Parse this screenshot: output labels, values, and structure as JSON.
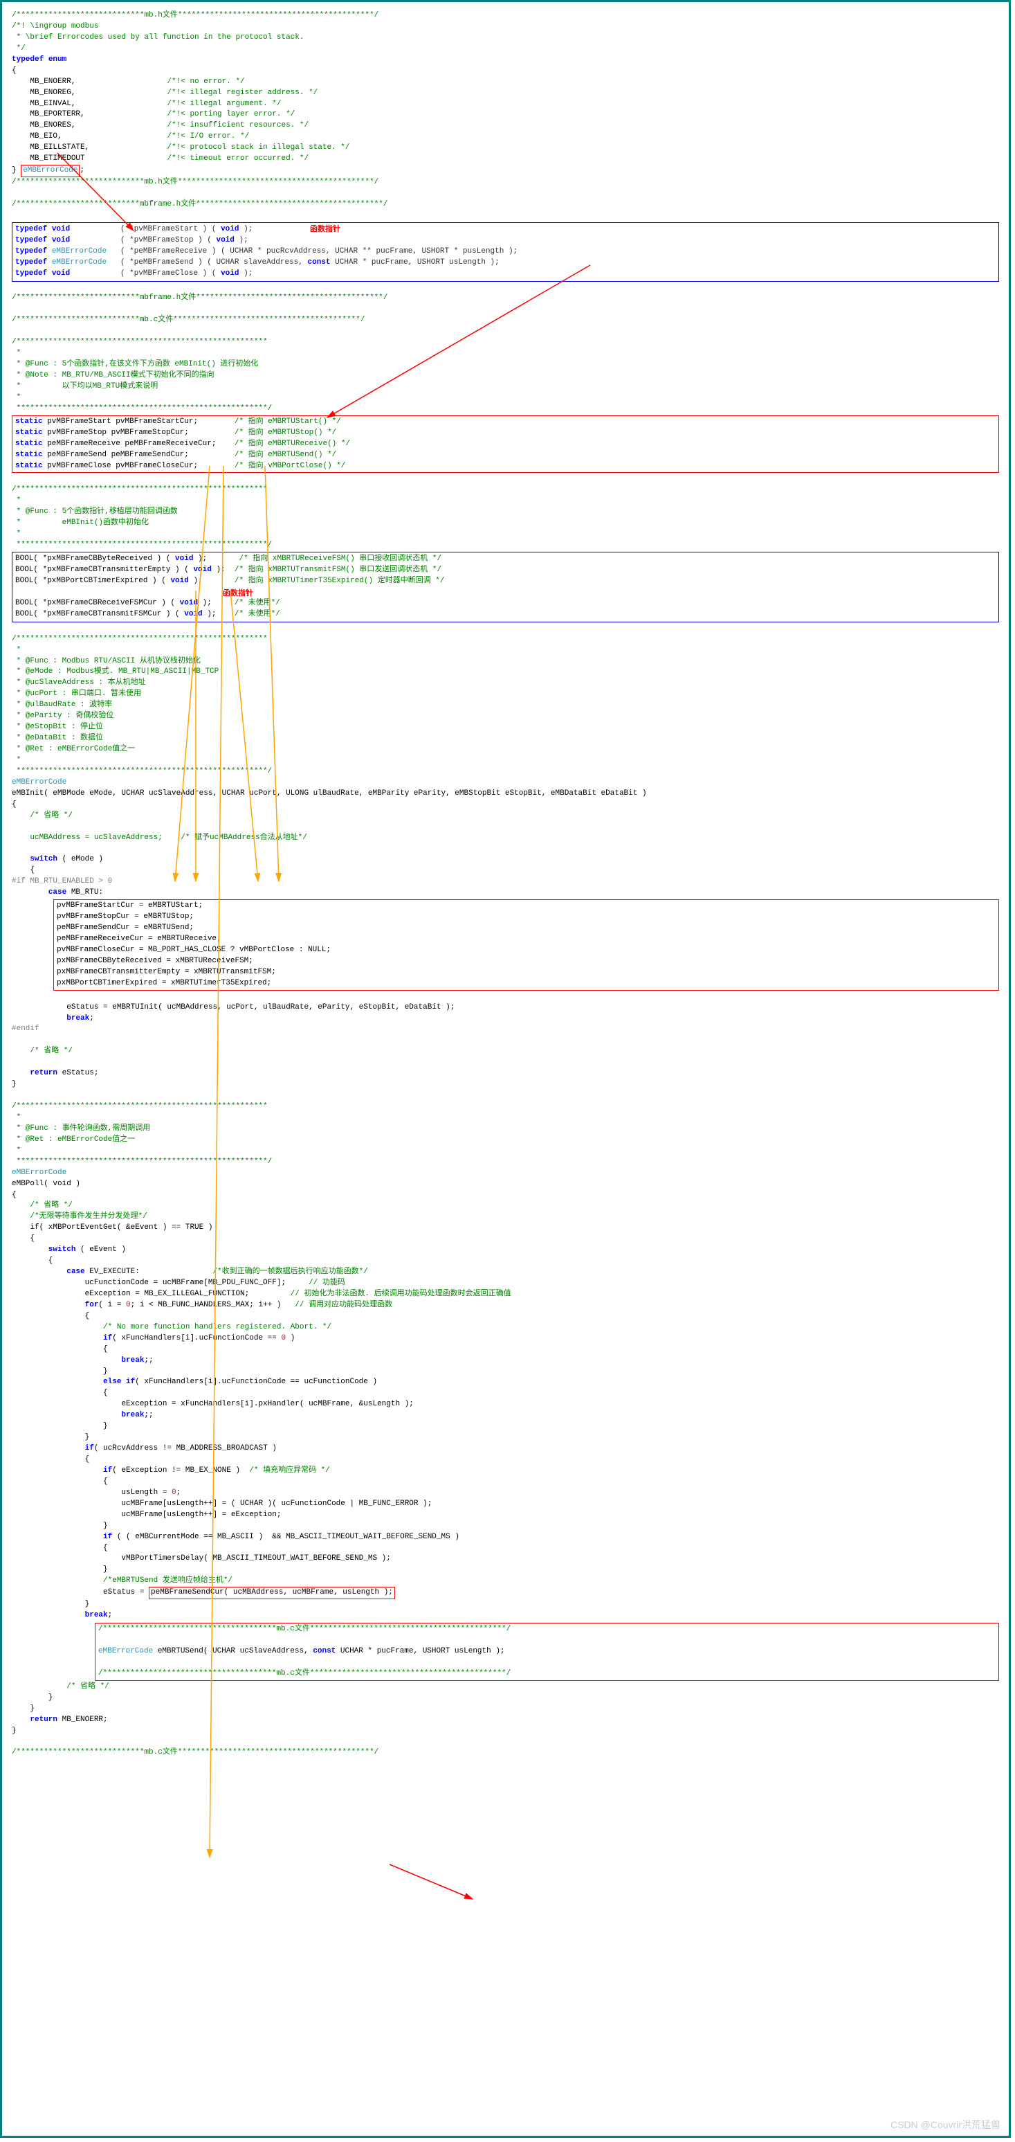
{
  "file_headers": {
    "mbh_start": "/****************************mb.h文件*******************************************/",
    "mbh_end": "/****************************mb.h文件*******************************************/",
    "mbframeh_start": "/***************************mbframe.h文件*****************************************/",
    "mbframeh_end": "/***************************mbframe.h文件*****************************************/",
    "mbc_start": "/***************************mb.c文件*****************************************/",
    "mbc_end": "/****************************mb.c文件*******************************************/",
    "mbc_inner_start": "/**************************************mb.c文件*******************************************/",
    "mbc_inner_end": "/**************************************mb.c文件*******************************************/"
  },
  "section1": {
    "doc1": "/*! \\ingroup modbus",
    "doc2": " * \\brief Errorcodes used by all function in the protocol stack.",
    "doc3": " */",
    "typedef": "typedef",
    "enum": " enum",
    "open": "{",
    "items": [
      {
        "name": "    MB_ENOERR,",
        "cmt": "                    /*!< no error. */"
      },
      {
        "name": "    MB_ENOREG,",
        "cmt": "                    /*!< illegal register address. */"
      },
      {
        "name": "    MB_EINVAL,",
        "cmt": "                    /*!< illegal argument. */"
      },
      {
        "name": "    MB_EPORTERR,",
        "cmt": "                  /*!< porting layer error. */"
      },
      {
        "name": "    MB_ENORES,",
        "cmt": "                    /*!< insufficient resources. */"
      },
      {
        "name": "    MB_EIO,",
        "cmt": "                       /*!< I/O error. */"
      },
      {
        "name": "    MB_EILLSTATE,",
        "cmt": "                 /*!< protocol stack in illegal state. */"
      },
      {
        "name": "    MB_ETIMEDOUT",
        "cmt": "                  /*!< timeout error occurred. */"
      }
    ],
    "close": "}",
    "typename": "eMBErrorCode",
    "semi": ";"
  },
  "annotations": {
    "fnptr1": "函数指针",
    "fnptr2": "函数指针"
  },
  "section2": {
    "lines": [
      "typedef void           ( *pvMBFrameStart ) ( void );",
      "typedef void           ( *pvMBFrameStop ) ( void );",
      "typedef eMBErrorCode   ( *peMBFrameReceive ) ( UCHAR * pucRcvAddress, UCHAR ** pucFrame, USHORT * pusLength );",
      "typedef eMBErrorCode   ( *peMBFrameSend ) ( UCHAR slaveAddress, const UCHAR * pucFrame, USHORT usLength );",
      "typedef void           ( *pvMBFrameClose ) ( void );"
    ]
  },
  "section3": {
    "header": [
      "/*******************************************************",
      " *",
      " * @Func : 5个函数指针,在该文件下方函数 eMBInit() 进行初始化",
      " * @Note : MB_RTU/MB_ASCII模式下初始化不同的指向",
      " *         以下均以MB_RTU模式来说明",
      " *",
      " *******************************************************/"
    ],
    "lines": [
      {
        "code": "static pvMBFrameStart pvMBFrameStartCur;",
        "cmt": "        /* 指向 eMBRTUStart() */"
      },
      {
        "code": "static pvMBFrameStop pvMBFrameStopCur;",
        "cmt": "          /* 指向 eMBRTUStop() */"
      },
      {
        "code": "static peMBFrameReceive peMBFrameReceiveCur;",
        "cmt": "    /* 指向 eMBRTUReceive() */"
      },
      {
        "code": "static peMBFrameSend peMBFrameSendCur;",
        "cmt": "          /* 指向 eMBRTUSend() */"
      },
      {
        "code": "static pvMBFrameClose pvMBFrameCloseCur;",
        "cmt": "        /* 指向 vMBPortClose() */"
      }
    ]
  },
  "section4": {
    "header": [
      "/*******************************************************",
      " *",
      " * @Func : 5个函数指针,移植层功能回调函数",
      " *         eMBInit()函数中初始化",
      " *",
      " *******************************************************/"
    ],
    "lines": [
      {
        "code": "BOOL( *pxMBFrameCBByteReceived ) ( void );",
        "cmt": "       /* 指向 xMBRTUReceiveFSM() 串口接收回调状态机 */"
      },
      {
        "code": "BOOL( *pxMBFrameCBTransmitterEmpty ) ( void );",
        "cmt": "  /* 指向 xMBRTUTransmitFSM() 串口发送回调状态机 */"
      },
      {
        "code": "BOOL( *pxMBPortCBTimerExpired ) ( void );",
        "cmt": "       /* 指向 xMBRTUTimerT35Expired() 定时器中断回调 */"
      }
    ],
    "lines2": [
      {
        "code": "BOOL( *pxMBFrameCBReceiveFSMCur ) ( void );",
        "cmt": "     /* 未使用*/"
      },
      {
        "code": "BOOL( *pxMBFrameCBTransmitFSMCur ) ( void );",
        "cmt": "    /* 未使用*/"
      }
    ]
  },
  "section5": {
    "header": [
      "/*******************************************************",
      " *",
      " * @Func : Modbus RTU/ASCII 从机协议栈初始化",
      " * @eMode : Modbus模式. MB_RTU|MB_ASCII|MB_TCP",
      " * @ucSlaveAddress : 本从机地址",
      " * @ucPort : 串口端口. 暂未使用",
      " * @ulBaudRate : 波特率",
      " * @eParity : 奇偶校验位",
      " * @eStopBit : 停止位",
      " * @eDataBit : 数据位",
      " * @Ret : eMBErrorCode值之一",
      " *",
      " *******************************************************/"
    ],
    "sig1": "eMBErrorCode",
    "sig2": "eMBInit( eMBMode eMode, UCHAR ucSlaveAddress, UCHAR ucPort, ULONG ulBaudRate, eMBParity eParity, eMBStopBit eStopBit, eMBDataBit eDataBit )",
    "body": [
      "{",
      "    /* 省略 */",
      "",
      "    ucMBAddress = ucSlaveAddress;    /* 赋予ucMBAddress合法从地址*/",
      "",
      "    switch ( eMode )",
      "    {"
    ],
    "ifguard": "#if MB_RTU_ENABLED > 0",
    "caselabel": "        case MB_RTU:",
    "assign": [
      "            pvMBFrameStartCur = eMBRTUStart;",
      "            pvMBFrameStopCur = eMBRTUStop;",
      "            peMBFrameSendCur = eMBRTUSend;",
      "            peMBFrameReceiveCur = eMBRTUReceive;",
      "            pvMBFrameCloseCur = MB_PORT_HAS_CLOSE ? vMBPortClose : NULL;",
      "            pxMBFrameCBByteReceived = xMBRTUReceiveFSM;",
      "            pxMBFrameCBTransmitterEmpty = xMBRTUTransmitFSM;",
      "            pxMBPortCBTimerExpired = xMBRTUTimerT35Expired;"
    ],
    "after": [
      "",
      "            eStatus = eMBRTUInit( ucMBAddress, ucPort, ulBaudRate, eParity, eStopBit, eDataBit );",
      "            break;"
    ],
    "endif": "#endif",
    "rest": [
      "",
      "    /* 省略 */",
      "",
      "    return eStatus;",
      "}"
    ]
  },
  "section6": {
    "header": [
      "/*******************************************************",
      " *",
      " * @Func : 事件轮询函数,需周期调用",
      " * @Ret : eMBErrorCode值之一",
      " *",
      " *******************************************************/"
    ],
    "sig1": "eMBErrorCode",
    "sig2": "eMBPoll( void )",
    "l": {
      "open": "{",
      "omit": "    /* 省略 */",
      "blank": "",
      "cmt_wait": "    /*无限等待事件发生并分发处理*/",
      "if1": "    if( xMBPortEventGet( &eEvent ) == TRUE )",
      "open2": "    {",
      "switch": "        switch ( eEvent )",
      "open3": "        {",
      "case": "            case EV_EXECUTE:",
      "case_cmt": "                /*收到正确的一帧数据后执行响应功能函数*/",
      "l1": "                ucFunctionCode = ucMBFrame[MB_PDU_FUNC_OFF];",
      "l1_cmt": "     // 功能码",
      "l2": "                eException = MB_EX_ILLEGAL_FUNCTION;",
      "l2_cmt": "         // 初始化为非法函数. 后续调用功能码处理函数时会返回正确值",
      "l3": "                for( i = 0; i < MB_FUNC_HANDLERS_MAX; i++ )",
      "l3_cmt": "   // 调用对应功能码处理函数",
      "open4": "                {",
      "l4": "                    /* No more function handlers registered. Abort. */",
      "l5": "                    if( xFuncHandlers[i].ucFunctionCode == 0 )",
      "open5": "                    {",
      "brk": "                        break;",
      "close5": "                    }",
      "l6": "                    else if( xFuncHandlers[i].ucFunctionCode == ucFunctionCode )",
      "open6": "                    {",
      "l7": "                        eException = xFuncHandlers[i].pxHandler( ucMBFrame, &usLength );",
      "brk2": "                        break;",
      "close6": "                    }",
      "close4": "                }",
      "l8": "                if( ucRcvAddress != MB_ADDRESS_BROADCAST )",
      "open7": "                {",
      "l9": "                    if( eException != MB_EX_NONE )",
      "l9_cmt": "  /* 填充响应异常码 */",
      "open8": "                    {",
      "l10": "                        usLength = 0;",
      "l11": "                        ucMBFrame[usLength++] = ( UCHAR )( ucFunctionCode | MB_FUNC_ERROR );",
      "l12": "                        ucMBFrame[usLength++] = eException;",
      "close8": "                    }",
      "l13": "                    if ( ( eMBCurrentMode == MB_ASCII )  && MB_ASCII_TIMEOUT_WAIT_BEFORE_SEND_MS )",
      "open9": "                    {",
      "l14": "                        vMBPortTimersDelay( MB_ASCII_TIMEOUT_WAIT_BEFORE_SEND_MS );",
      "close9": "                    }",
      "cmt_send": "                    /*eMBRTUSend 发送响应帧给主机*/",
      "l15_pre": "                    eStatus = ",
      "l15_box": "peMBFrameSendCur( ucMBAddress, ucMBFrame, usLength );",
      "close7": "                }",
      "brk3": "                break;",
      "omit2": "            /* 省略 */",
      "close3": "        }",
      "close2": "    }",
      "ret": "    return MB_ENOERR;",
      "close": "}"
    }
  },
  "section7": {
    "sig": "eMBErrorCode eMBRTUSend( UCHAR ucSlaveAddress, const UCHAR * pucFrame, USHORT usLength );"
  },
  "watermark": "CSDN @Couvrir洪荒猛兽"
}
